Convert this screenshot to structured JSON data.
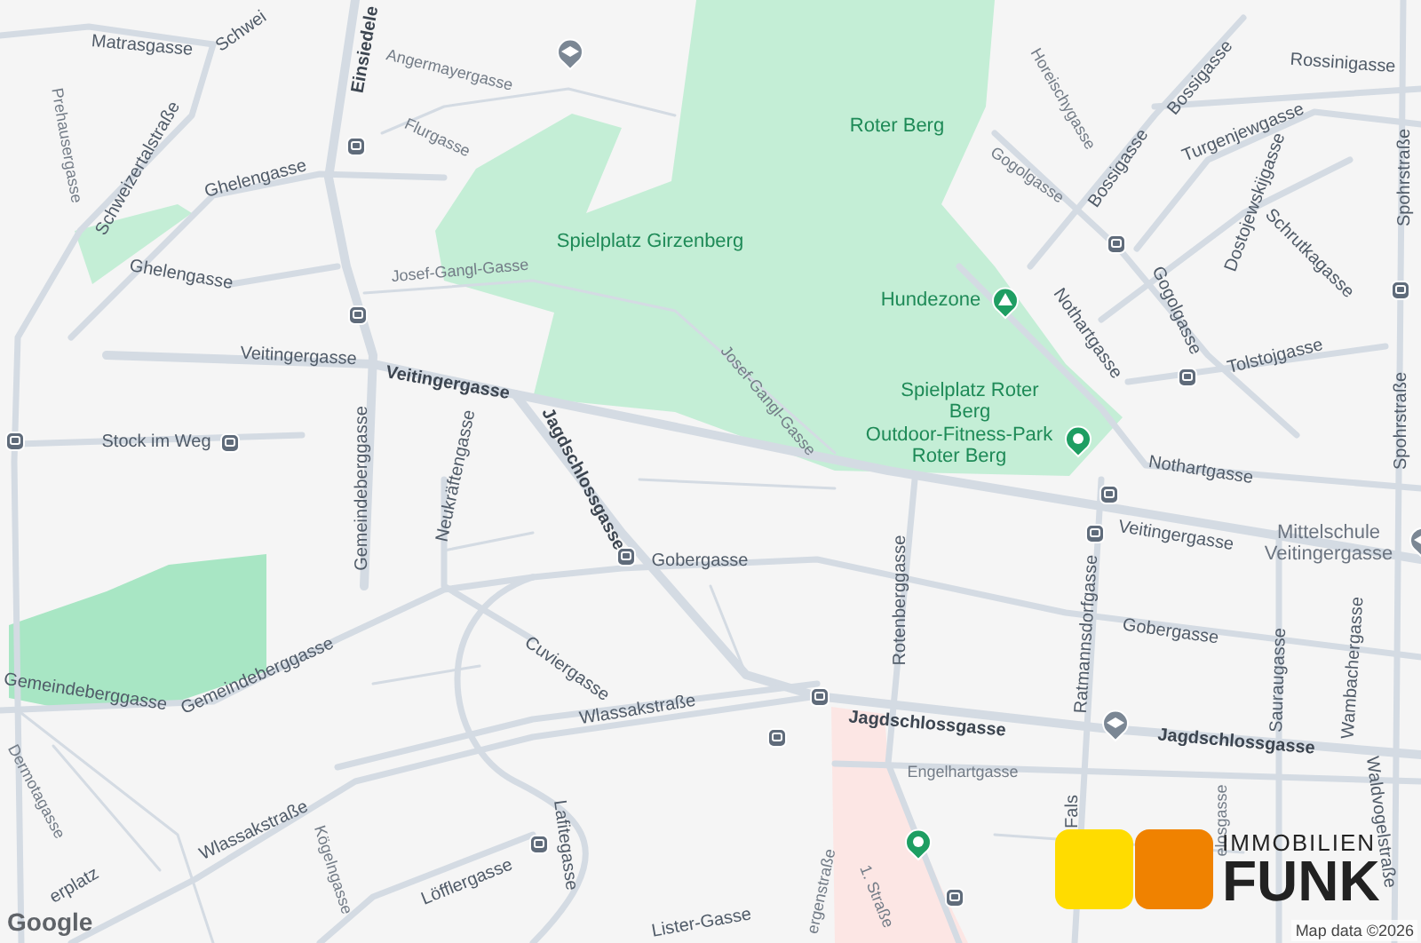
{
  "map": {
    "labels": [
      {
        "text": "Matrasgasse",
        "kind": "street"
      },
      {
        "text": "Schwei",
        "kind": "street"
      },
      {
        "text": "Einsiedele",
        "kind": "major"
      },
      {
        "text": "Angermayergasse",
        "kind": "minor"
      },
      {
        "text": "Prehausergasse",
        "kind": "minor"
      },
      {
        "text": "Schweizertalstraße",
        "kind": "street"
      },
      {
        "text": "Flurgasse",
        "kind": "minor"
      },
      {
        "text": "Ghelengasse",
        "kind": "street"
      },
      {
        "text": "Ghelengasse",
        "kind": "street"
      },
      {
        "text": "Spielplatz Girzenberg",
        "kind": "park"
      },
      {
        "text": "Roter Berg",
        "kind": "park"
      },
      {
        "text": "Horeischygasse",
        "kind": "minor"
      },
      {
        "text": "Bossigasse",
        "kind": "street"
      },
      {
        "text": "Bossigasse",
        "kind": "street"
      },
      {
        "text": "Rossinigasse",
        "kind": "street"
      },
      {
        "text": "Gogolgasse",
        "kind": "minor"
      },
      {
        "text": "Turgenjewgasse",
        "kind": "street"
      },
      {
        "text": "Dostojewskijgasse",
        "kind": "street"
      },
      {
        "text": "Spohrstraße",
        "kind": "street"
      },
      {
        "text": "Schrutkagasse",
        "kind": "street"
      },
      {
        "text": "Gogolgasse",
        "kind": "street"
      },
      {
        "text": "Nothartgasse",
        "kind": "street"
      },
      {
        "text": "Hundezone",
        "kind": "park"
      },
      {
        "text": "Josef-Gangl-Gasse",
        "kind": "minor"
      },
      {
        "text": "Josef-Gangl-Gasse",
        "kind": "minor"
      },
      {
        "text": "Veitingergasse",
        "kind": "street"
      },
      {
        "text": "Veitingergasse",
        "kind": "major"
      },
      {
        "text": "Tolstojgasse",
        "kind": "street"
      },
      {
        "text": "Spielplatz Roter Berg",
        "kind": "park"
      },
      {
        "text": "Stock im Weg",
        "kind": "street"
      },
      {
        "text": "Outdoor-Fitness-Park Roter Berg",
        "kind": "park"
      },
      {
        "text": "Spohrstraße",
        "kind": "street"
      },
      {
        "text": "Gemeindeberggasse",
        "kind": "street"
      },
      {
        "text": "Neukräftengasse",
        "kind": "street"
      },
      {
        "text": "Jagdschlossgasse",
        "kind": "major"
      },
      {
        "text": "Nothartgasse",
        "kind": "street"
      },
      {
        "text": "Veitingergasse",
        "kind": "street"
      },
      {
        "text": "Gobergasse",
        "kind": "street"
      },
      {
        "text": "Mittelschule Veitingergasse",
        "kind": "school"
      },
      {
        "text": "Rotenberggasse",
        "kind": "street"
      },
      {
        "text": "Ratmannsdorfgasse",
        "kind": "street"
      },
      {
        "text": "Gobergasse",
        "kind": "street"
      },
      {
        "text": "Sauraugasse",
        "kind": "street"
      },
      {
        "text": "Wambachergasse",
        "kind": "street"
      },
      {
        "text": "Gemeindeberggasse",
        "kind": "street"
      },
      {
        "text": "Gemeindeberggasse",
        "kind": "street"
      },
      {
        "text": "Cuviergasse",
        "kind": "street"
      },
      {
        "text": "Wlassakstraße",
        "kind": "street"
      },
      {
        "text": "Jagdschlossgasse",
        "kind": "major"
      },
      {
        "text": "Jagdschlossgasse",
        "kind": "major"
      },
      {
        "text": "Engelhartgasse",
        "kind": "minor"
      },
      {
        "text": "Wlassakstraße",
        "kind": "street"
      },
      {
        "text": "Dermotagasse",
        "kind": "minor"
      },
      {
        "text": "Kögelngasse",
        "kind": "minor"
      },
      {
        "text": "Lafitegasse",
        "kind": "street"
      },
      {
        "text": "Löfflergasse",
        "kind": "street"
      },
      {
        "text": "erplatz",
        "kind": "street"
      },
      {
        "text": "ergenstraße",
        "kind": "minor"
      },
      {
        "text": "1. Straße",
        "kind": "minor"
      },
      {
        "text": "Fals",
        "kind": "street"
      },
      {
        "text": "elosgasse",
        "kind": "minor"
      },
      {
        "text": "Waldvogelstraße",
        "kind": "street"
      },
      {
        "text": "Lister-Gasse",
        "kind": "street"
      }
    ]
  },
  "logo": {
    "line_1": "IMMOBILIEN",
    "line_2": "FUNK"
  },
  "attribution": {
    "brand": "Google",
    "text": "Map data ©2026"
  }
}
